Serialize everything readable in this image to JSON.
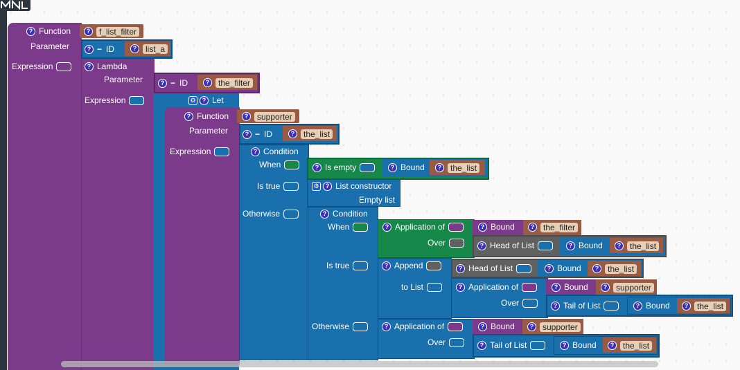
{
  "blocks": {
    "fn1_label": "Function",
    "fn1_name": "f_list_filter",
    "param1_label": "Parameter",
    "id1_label": "ID",
    "id1_name": "list_a",
    "expr1_label": "Expression",
    "lambda_label": "Lambda",
    "param2_label": "Parameter",
    "id2_label": "ID",
    "id2_name": "the_filter",
    "expr2_label": "Expression",
    "let_label": "Let",
    "fn2_label": "Function",
    "fn2_name": "supporter",
    "param3_label": "Parameter",
    "id3_label": "ID",
    "id3_name": "the_list",
    "expr3_label": "Expression",
    "cond1_label": "Condition",
    "when1_label": "When",
    "isempty_label": "Is empty",
    "bound1_label": "Bound",
    "bound1_name": "the_list",
    "istrue1_label": "Is true",
    "listcons_label": "List constructor",
    "emptylist_label": "Empty list",
    "otherwise1_label": "Otherwise",
    "cond2_label": "Condition",
    "when2_label": "When",
    "app1_label": "Application of",
    "bound2_label": "Bound",
    "bound2_name": "the_filter",
    "over1_label": "Over",
    "head1_label": "Head of List",
    "bound3_label": "Bound",
    "bound3_name": "the_list",
    "istrue2_label": "Is true",
    "append_label": "Append",
    "head2_label": "Head of List",
    "bound4_label": "Bound",
    "bound4_name": "the_list",
    "tolist_label": "to List",
    "app2_label": "Application of",
    "bound5_label": "Bound",
    "bound5_name": "supporter",
    "over2_label": "Over",
    "tail1_label": "Tail of List",
    "bound6_label": "Bound",
    "bound6_name": "the_list",
    "otherwise2_label": "Otherwise",
    "app3_label": "Application of",
    "bound7_label": "Bound",
    "bound7_name": "supporter",
    "over3_label": "Over",
    "tail2_label": "Tail of List",
    "bound8_label": "Bound",
    "bound8_name": "the_list"
  },
  "colors": {
    "function": "#7c3a8a",
    "id_field": "#9a5b45",
    "structure": "#1a6fad",
    "predicate": "#15884a",
    "list_op": "#606060",
    "toolbar": "#2c3440"
  },
  "icons": {
    "help": "question-icon",
    "mutator": "gear-icon",
    "logo": "mnl-logo-icon"
  }
}
